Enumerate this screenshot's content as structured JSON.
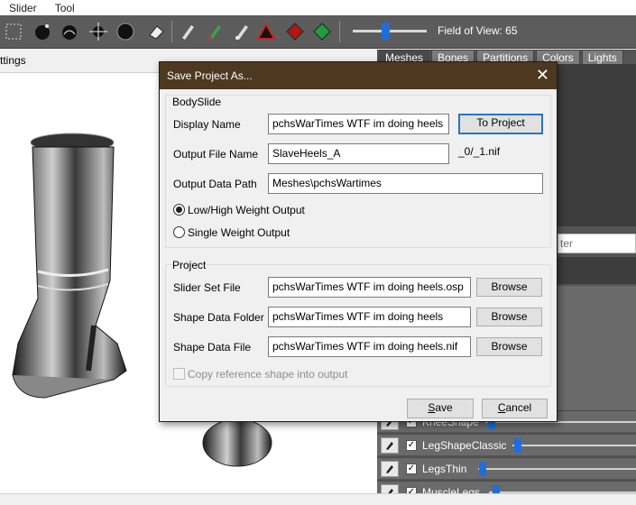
{
  "menu": {
    "items": [
      "Slider",
      "Tool"
    ]
  },
  "toolbar": {
    "fov_label": "Field of View: 65",
    "fov_value": 65
  },
  "left": {
    "settings_label": "ttings"
  },
  "right_panel": {
    "tabs": [
      "Meshes",
      "Bones",
      "Partitions",
      "Colors",
      "Lights"
    ],
    "filter_placeholder": "ter",
    "sliders": [
      {
        "name": "KneeShape",
        "value": 0.05
      },
      {
        "name": "LegShapeClassic",
        "value": 0.05
      },
      {
        "name": "LegsThin",
        "value": 0.05
      },
      {
        "name": "MuscleLegs",
        "value": 0.05
      }
    ]
  },
  "dialog": {
    "title": "Save Project As...",
    "close_glyph": "✕",
    "bodyslide": {
      "group_title": "BodySlide",
      "display_name_label": "Display Name",
      "display_name_value": "pchsWarTimes WTF im doing heels",
      "to_project_label": "To Project",
      "output_file_label": "Output File Name",
      "output_file_value": "SlaveHeels_A",
      "output_suffix": "_0/_1.nif",
      "output_path_label": "Output Data Path",
      "output_path_value": "Meshes\\pchsWartimes",
      "radio_low_high": "Low/High Weight Output",
      "radio_single": "Single Weight Output"
    },
    "project": {
      "group_title": "Project",
      "slider_set_label": "Slider Set File",
      "slider_set_value": "pchsWarTimes WTF im doing heels.osp",
      "shape_folder_label": "Shape Data Folder",
      "shape_folder_value": "pchsWarTimes WTF im doing heels",
      "shape_file_label": "Shape Data File",
      "shape_file_value": "pchsWarTimes WTF im doing heels.nif",
      "browse_label": "Browse",
      "copy_ref_label": "Copy reference shape into output"
    },
    "save_prefix": "S",
    "save_rest": "ave",
    "cancel_prefix": "C",
    "cancel_rest": "ancel"
  },
  "colors": {
    "title_bar": "#4e3920",
    "accent": "#1e6fd9",
    "toolbar": "#5c5c5c"
  }
}
